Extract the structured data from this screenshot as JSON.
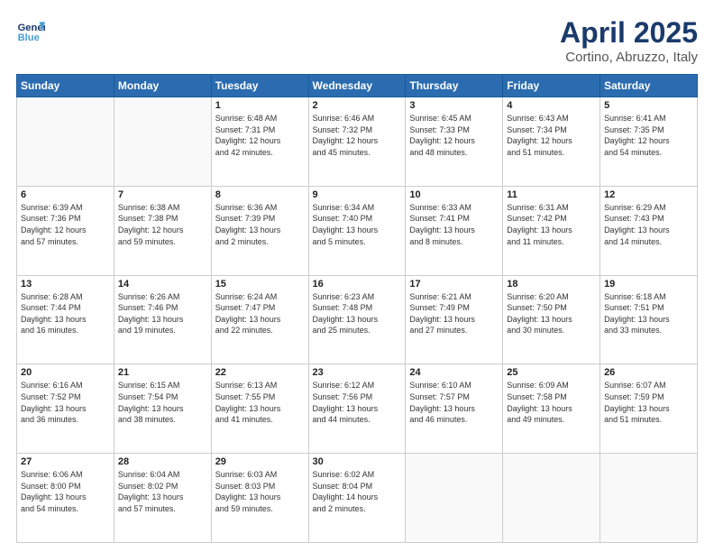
{
  "header": {
    "logo_general": "General",
    "logo_blue": "Blue",
    "title": "April 2025",
    "subtitle": "Cortino, Abruzzo, Italy"
  },
  "days_of_week": [
    "Sunday",
    "Monday",
    "Tuesday",
    "Wednesday",
    "Thursday",
    "Friday",
    "Saturday"
  ],
  "weeks": [
    [
      {
        "day": null,
        "info": null
      },
      {
        "day": null,
        "info": null
      },
      {
        "day": "1",
        "info": "Sunrise: 6:48 AM\nSunset: 7:31 PM\nDaylight: 12 hours\nand 42 minutes."
      },
      {
        "day": "2",
        "info": "Sunrise: 6:46 AM\nSunset: 7:32 PM\nDaylight: 12 hours\nand 45 minutes."
      },
      {
        "day": "3",
        "info": "Sunrise: 6:45 AM\nSunset: 7:33 PM\nDaylight: 12 hours\nand 48 minutes."
      },
      {
        "day": "4",
        "info": "Sunrise: 6:43 AM\nSunset: 7:34 PM\nDaylight: 12 hours\nand 51 minutes."
      },
      {
        "day": "5",
        "info": "Sunrise: 6:41 AM\nSunset: 7:35 PM\nDaylight: 12 hours\nand 54 minutes."
      }
    ],
    [
      {
        "day": "6",
        "info": "Sunrise: 6:39 AM\nSunset: 7:36 PM\nDaylight: 12 hours\nand 57 minutes."
      },
      {
        "day": "7",
        "info": "Sunrise: 6:38 AM\nSunset: 7:38 PM\nDaylight: 12 hours\nand 59 minutes."
      },
      {
        "day": "8",
        "info": "Sunrise: 6:36 AM\nSunset: 7:39 PM\nDaylight: 13 hours\nand 2 minutes."
      },
      {
        "day": "9",
        "info": "Sunrise: 6:34 AM\nSunset: 7:40 PM\nDaylight: 13 hours\nand 5 minutes."
      },
      {
        "day": "10",
        "info": "Sunrise: 6:33 AM\nSunset: 7:41 PM\nDaylight: 13 hours\nand 8 minutes."
      },
      {
        "day": "11",
        "info": "Sunrise: 6:31 AM\nSunset: 7:42 PM\nDaylight: 13 hours\nand 11 minutes."
      },
      {
        "day": "12",
        "info": "Sunrise: 6:29 AM\nSunset: 7:43 PM\nDaylight: 13 hours\nand 14 minutes."
      }
    ],
    [
      {
        "day": "13",
        "info": "Sunrise: 6:28 AM\nSunset: 7:44 PM\nDaylight: 13 hours\nand 16 minutes."
      },
      {
        "day": "14",
        "info": "Sunrise: 6:26 AM\nSunset: 7:46 PM\nDaylight: 13 hours\nand 19 minutes."
      },
      {
        "day": "15",
        "info": "Sunrise: 6:24 AM\nSunset: 7:47 PM\nDaylight: 13 hours\nand 22 minutes."
      },
      {
        "day": "16",
        "info": "Sunrise: 6:23 AM\nSunset: 7:48 PM\nDaylight: 13 hours\nand 25 minutes."
      },
      {
        "day": "17",
        "info": "Sunrise: 6:21 AM\nSunset: 7:49 PM\nDaylight: 13 hours\nand 27 minutes."
      },
      {
        "day": "18",
        "info": "Sunrise: 6:20 AM\nSunset: 7:50 PM\nDaylight: 13 hours\nand 30 minutes."
      },
      {
        "day": "19",
        "info": "Sunrise: 6:18 AM\nSunset: 7:51 PM\nDaylight: 13 hours\nand 33 minutes."
      }
    ],
    [
      {
        "day": "20",
        "info": "Sunrise: 6:16 AM\nSunset: 7:52 PM\nDaylight: 13 hours\nand 36 minutes."
      },
      {
        "day": "21",
        "info": "Sunrise: 6:15 AM\nSunset: 7:54 PM\nDaylight: 13 hours\nand 38 minutes."
      },
      {
        "day": "22",
        "info": "Sunrise: 6:13 AM\nSunset: 7:55 PM\nDaylight: 13 hours\nand 41 minutes."
      },
      {
        "day": "23",
        "info": "Sunrise: 6:12 AM\nSunset: 7:56 PM\nDaylight: 13 hours\nand 44 minutes."
      },
      {
        "day": "24",
        "info": "Sunrise: 6:10 AM\nSunset: 7:57 PM\nDaylight: 13 hours\nand 46 minutes."
      },
      {
        "day": "25",
        "info": "Sunrise: 6:09 AM\nSunset: 7:58 PM\nDaylight: 13 hours\nand 49 minutes."
      },
      {
        "day": "26",
        "info": "Sunrise: 6:07 AM\nSunset: 7:59 PM\nDaylight: 13 hours\nand 51 minutes."
      }
    ],
    [
      {
        "day": "27",
        "info": "Sunrise: 6:06 AM\nSunset: 8:00 PM\nDaylight: 13 hours\nand 54 minutes."
      },
      {
        "day": "28",
        "info": "Sunrise: 6:04 AM\nSunset: 8:02 PM\nDaylight: 13 hours\nand 57 minutes."
      },
      {
        "day": "29",
        "info": "Sunrise: 6:03 AM\nSunset: 8:03 PM\nDaylight: 13 hours\nand 59 minutes."
      },
      {
        "day": "30",
        "info": "Sunrise: 6:02 AM\nSunset: 8:04 PM\nDaylight: 14 hours\nand 2 minutes."
      },
      {
        "day": null,
        "info": null
      },
      {
        "day": null,
        "info": null
      },
      {
        "day": null,
        "info": null
      }
    ]
  ]
}
